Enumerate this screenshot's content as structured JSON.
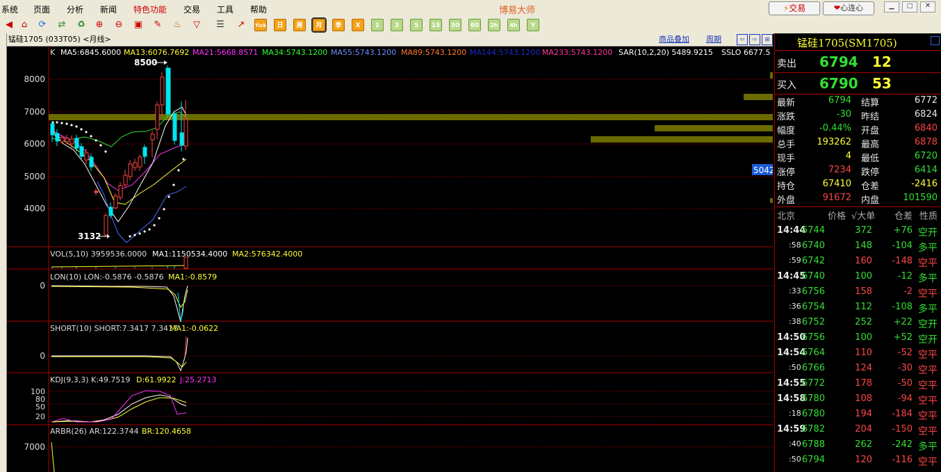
{
  "menu": {
    "items": [
      "系统",
      "页面",
      "分析",
      "新闻",
      "特色功能",
      "交易",
      "工具",
      "帮助"
    ],
    "app_title": "博易大师",
    "trade_button": "交易",
    "xinlianxin_button": "心连心"
  },
  "toolbar": {
    "labels": [
      "Tick",
      "日",
      "周",
      "月",
      "季",
      "1",
      "3",
      "5",
      "15",
      "30",
      "60",
      "2h",
      "4h",
      "Y"
    ]
  },
  "chart": {
    "header_left": "锰硅1705 (033T05) <月线>",
    "overlay_link": "商品叠加",
    "period_link": "周期",
    "price_panel": {
      "label": "K",
      "indicators": [
        {
          "text": "MA5:6845.6000",
          "color": "#ffffff"
        },
        {
          "text": "MA13:6076.7692",
          "color": "#ffff33"
        },
        {
          "text": "MA21:5668.8571",
          "color": "#ff33ff"
        },
        {
          "text": "MA34:5743.1200",
          "color": "#33ff33"
        },
        {
          "text": "MA55:5743.1200",
          "color": "#6a8cff"
        },
        {
          "text": "MA89:5743.1200",
          "color": "#ff7a30"
        },
        {
          "text": "MA144:5743.1200",
          "color": "#1a2cc8"
        },
        {
          "text": "MA233:5743.1200",
          "color": "#ff3aa0"
        },
        {
          "text": "SAR(10,2,20)  5489.9215",
          "color": "#ffffff"
        },
        {
          "text": "SSLO  6677.5",
          "color": "#ffffff"
        }
      ],
      "yticks": [
        "8000",
        "7000",
        "6000",
        "5000",
        "4000"
      ],
      "high_label": "8500",
      "low_label": "3132",
      "right_tag": "5042"
    },
    "vol_panel": {
      "label": "VOL(5,10) 3959536.0000",
      "ma1": "MA1:1150534.4000",
      "ma2": "MA2:576342.4000"
    },
    "lon_panel": {
      "label": "LON(10) LON:-0.5876  -0.5876",
      "ma1": "MA1:-0.8579",
      "ytick": "0"
    },
    "short_panel": {
      "label": "SHORT(10) SHORT:7.3417  7.3417",
      "ma1": "MA1:-0.0622",
      "ytick": "0"
    },
    "kdj_panel": {
      "label": "KDJ(9,3,3) K:49.7519",
      "d": "D:61.9922",
      "j": "J:25.2713",
      "yticks": [
        "100",
        "80",
        "50",
        "20"
      ]
    },
    "arbr_panel": {
      "label": "ARBR(26) AR:122.3744",
      "br": "BR:120.4658",
      "ytick": "7000"
    }
  },
  "quote": {
    "title": "锰硅1705(SM1705)",
    "sell": {
      "label": "卖出",
      "price": "6794",
      "vol": "12"
    },
    "buy": {
      "label": "买入",
      "price": "6790",
      "vol": "53"
    },
    "stats": [
      {
        "l1": "最新",
        "v1": "6794",
        "c1": "grn",
        "l2": "结算",
        "v2": "6772",
        "c2": "wht"
      },
      {
        "l1": "涨跌",
        "v1": "-30",
        "c1": "grn",
        "l2": "昨结",
        "v2": "6824",
        "c2": "wht"
      },
      {
        "l1": "幅度",
        "v1": "-0.44%",
        "c1": "grn",
        "l2": "开盘",
        "v2": "6840",
        "c2": "red"
      },
      {
        "l1": "总手",
        "v1": "193262",
        "c1": "yel",
        "l2": "最高",
        "v2": "6878",
        "c2": "red"
      },
      {
        "l1": "现手",
        "v1": "4",
        "c1": "yel",
        "l2": "最低",
        "v2": "6720",
        "c2": "grn"
      },
      {
        "l1": "涨停",
        "v1": "7234",
        "c1": "red",
        "l2": "跌停",
        "v2": "6414",
        "c2": "grn"
      },
      {
        "l1": "持仓",
        "v1": "67410",
        "c1": "yel",
        "l2": "仓差",
        "v2": "-2416",
        "c2": "yel"
      },
      {
        "l1": "外盘",
        "v1": "91672",
        "c1": "red",
        "l2": "内盘",
        "v2": "101590",
        "c2": "grn"
      }
    ],
    "ticks_header": {
      "c1": "北京",
      "c2": "价格",
      "c3": "√大单",
      "c4": "仓差",
      "c5": "性质"
    },
    "ticks": [
      {
        "time": "14:44",
        "price": "6744",
        "vol": "372",
        "diff": "+76",
        "nature": "空开",
        "dc": "grn"
      },
      {
        "time": ":58",
        "price": "6740",
        "vol": "148",
        "diff": "-104",
        "nature": "多平",
        "dc": "grn"
      },
      {
        "time": ":59",
        "price": "6742",
        "vol": "160",
        "diff": "-148",
        "nature": "空平",
        "dc": "red"
      },
      {
        "time": "14:45",
        "price": "6740",
        "vol": "100",
        "diff": "-12",
        "nature": "多平",
        "dc": "grn"
      },
      {
        "time": ":33",
        "price": "6756",
        "vol": "158",
        "diff": "-2",
        "nature": "空平",
        "dc": "red"
      },
      {
        "time": ":36",
        "price": "6754",
        "vol": "112",
        "diff": "-108",
        "nature": "多平",
        "dc": "grn"
      },
      {
        "time": ":38",
        "price": "6752",
        "vol": "252",
        "diff": "+22",
        "nature": "空开",
        "dc": "grn"
      },
      {
        "time": "14:50",
        "price": "6756",
        "vol": "100",
        "diff": "+52",
        "nature": "空开",
        "dc": "grn"
      },
      {
        "time": "14:54",
        "price": "6764",
        "vol": "110",
        "diff": "-52",
        "nature": "空平",
        "dc": "red"
      },
      {
        "time": ":50",
        "price": "6766",
        "vol": "124",
        "diff": "-30",
        "nature": "空平",
        "dc": "red"
      },
      {
        "time": "14:55",
        "price": "6772",
        "vol": "178",
        "diff": "-50",
        "nature": "空平",
        "dc": "red"
      },
      {
        "time": "14:58",
        "price": "6780",
        "vol": "108",
        "diff": "-94",
        "nature": "空平",
        "dc": "red"
      },
      {
        "time": ":18",
        "price": "6780",
        "vol": "194",
        "diff": "-184",
        "nature": "空平",
        "dc": "red"
      },
      {
        "time": "14:59",
        "price": "6782",
        "vol": "204",
        "diff": "-150",
        "nature": "空平",
        "dc": "red"
      },
      {
        "time": ":40",
        "price": "6788",
        "vol": "262",
        "diff": "-242",
        "nature": "多平",
        "dc": "grn"
      },
      {
        "time": ":50",
        "price": "6794",
        "vol": "120",
        "diff": "-116",
        "nature": "空平",
        "dc": "red"
      }
    ]
  }
}
